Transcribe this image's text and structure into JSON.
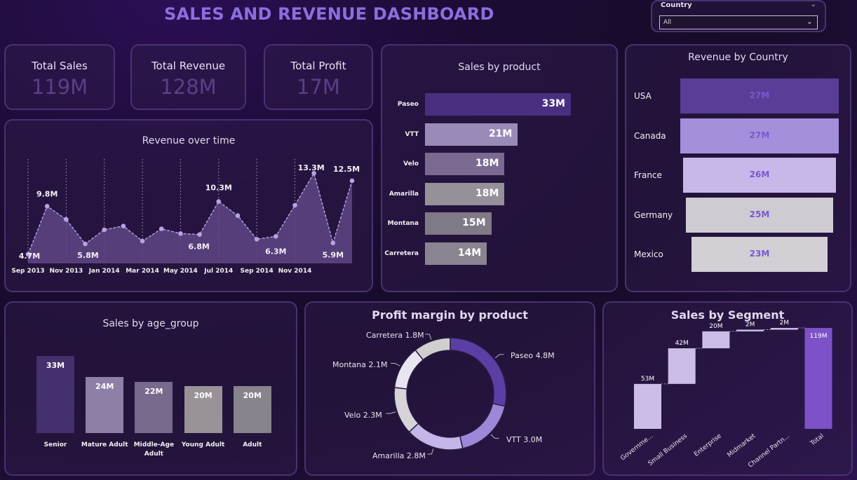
{
  "header": {
    "title": "SALES AND REVENUE DASHBOARD"
  },
  "filter": {
    "label": "Country",
    "selected": "All"
  },
  "kpis": [
    {
      "label": "Total Sales",
      "value": "119M"
    },
    {
      "label": "Total Revenue",
      "value": "128M"
    },
    {
      "label": "Total Profit",
      "value": "17M"
    }
  ],
  "revenue_over_time": {
    "title": "Revenue over time",
    "tick_labels": [
      "Sep 2013",
      "Nov 2013",
      "Jan 2014",
      "Mar 2014",
      "May 2014",
      "Jul 2014",
      "Sep 2014",
      "Nov 2014"
    ],
    "data_labels": [
      {
        "idx": 0,
        "text": "4.7M"
      },
      {
        "idx": 1,
        "text": "9.8M"
      },
      {
        "idx": 3,
        "text": "5.8M"
      },
      {
        "idx": 9,
        "text": "6.8M"
      },
      {
        "idx": 10,
        "text": "10.3M"
      },
      {
        "idx": 13,
        "text": "6.3M"
      },
      {
        "idx": 15,
        "text": "13.3M"
      },
      {
        "idx": 16,
        "text": "5.9M"
      },
      {
        "idx": 17,
        "text": "12.5M"
      }
    ]
  },
  "sales_by_product": {
    "title": "Sales by product",
    "items": [
      {
        "label": "Paseo",
        "value_text": "33M",
        "color": "#4a2f80"
      },
      {
        "label": "VTT",
        "value_text": "21M",
        "color": "#9a8ab8"
      },
      {
        "label": "Velo",
        "value_text": "18M",
        "color": "#7a6a92"
      },
      {
        "label": "Amarilla",
        "value_text": "18M",
        "color": "#969098"
      },
      {
        "label": "Montana",
        "value_text": "15M",
        "color": "#807a86"
      },
      {
        "label": "Carretera",
        "value_text": "14M",
        "color": "#8a8490"
      }
    ]
  },
  "revenue_by_country": {
    "title": "Revenue by Country",
    "items": [
      {
        "label": "USA",
        "value_text": "27M",
        "color": "#5a3d96"
      },
      {
        "label": "Canada",
        "value_text": "27M",
        "color": "#a48fdc"
      },
      {
        "label": "France",
        "value_text": "26M",
        "color": "#c8b8ea"
      },
      {
        "label": "Germany",
        "value_text": "25M",
        "color": "#cfcbd3"
      },
      {
        "label": "Mexico",
        "value_text": "23M",
        "color": "#d2d0d4"
      }
    ]
  },
  "sales_by_age_group": {
    "title": "Sales by age_group",
    "items": [
      {
        "label": "Senior",
        "value_text": "33M",
        "color": "#45306e"
      },
      {
        "label": "Mature Adult",
        "value_text": "24M",
        "color": "#8e7fa6"
      },
      {
        "label": "Middle-Age Adult",
        "value_text": "22M",
        "color": "#786a8c"
      },
      {
        "label": "Young Adult",
        "value_text": "20M",
        "color": "#999398"
      },
      {
        "label": "Adult",
        "value_text": "20M",
        "color": "#88838c"
      }
    ]
  },
  "profit_margin_by_product": {
    "title": "Profit margin by product",
    "items": [
      {
        "label": "Paseo 4.8M",
        "color": "#5b3fa5"
      },
      {
        "label": "VTT 3.0M",
        "color": "#9c87d8"
      },
      {
        "label": "Amarilla 2.8M",
        "color": "#c4b6e8"
      },
      {
        "label": "Velo 2.3M",
        "color": "#d6d4d8"
      },
      {
        "label": "Montana 2.1M",
        "color": "#e8e4f0"
      },
      {
        "label": "Carretera 1.8M",
        "color": "#cfcfcf"
      }
    ]
  },
  "sales_by_segment": {
    "title": "Sales by Segment",
    "items": [
      {
        "label": "Governme...",
        "value_text": "53M"
      },
      {
        "label": "Small Business",
        "value_text": "42M"
      },
      {
        "label": "Enterprise",
        "value_text": "20M"
      },
      {
        "label": "Midmarket",
        "value_text": "2M"
      },
      {
        "label": "Channel Partn...",
        "value_text": "2M"
      },
      {
        "label": "Total",
        "value_text": "119M"
      }
    ]
  },
  "chart_data": [
    {
      "type": "area",
      "title": "Revenue over time",
      "x": [
        "Sep 2013",
        "Oct 2013",
        "Nov 2013",
        "Dec 2013",
        "Jan 2014",
        "Feb 2014",
        "Mar 2014",
        "Apr 2014",
        "May 2014",
        "Jun 2014",
        "Jul 2014",
        "Aug 2014",
        "Sep 2014",
        "Oct 2014",
        "Nov 2014",
        "Dec 2014",
        "Jan 2015",
        "Feb 2015"
      ],
      "values": [
        4.7,
        9.8,
        8.4,
        5.8,
        7.3,
        7.7,
        6.1,
        7.4,
        6.9,
        6.8,
        10.3,
        8.8,
        6.3,
        6.6,
        9.9,
        13.3,
        5.9,
        12.5
      ],
      "ylim": [
        3.8,
        14.8
      ]
    },
    {
      "type": "bar",
      "title": "Sales by product",
      "categories": [
        "Paseo",
        "VTT",
        "Velo",
        "Amarilla",
        "Montana",
        "Carretera"
      ],
      "values": [
        33,
        21,
        18,
        18,
        15,
        14
      ]
    },
    {
      "type": "bar",
      "title": "Revenue by Country",
      "categories": [
        "USA",
        "Canada",
        "France",
        "Germany",
        "Mexico"
      ],
      "values": [
        27,
        27,
        26,
        25,
        23
      ]
    },
    {
      "type": "bar",
      "title": "Sales by age_group",
      "categories": [
        "Senior",
        "Mature Adult",
        "Middle-Age Adult",
        "Young Adult",
        "Adult"
      ],
      "values": [
        33,
        24,
        22,
        20,
        20
      ]
    },
    {
      "type": "pie",
      "title": "Profit margin by product",
      "categories": [
        "Paseo",
        "VTT",
        "Amarilla",
        "Velo",
        "Montana",
        "Carretera"
      ],
      "values": [
        4.8,
        3.0,
        2.8,
        2.3,
        2.1,
        1.8
      ]
    },
    {
      "type": "bar",
      "title": "Sales by Segment",
      "categories": [
        "Government",
        "Small Business",
        "Enterprise",
        "Midmarket",
        "Channel Partners",
        "Total"
      ],
      "values": [
        53,
        42,
        20,
        2,
        2,
        119
      ]
    }
  ]
}
